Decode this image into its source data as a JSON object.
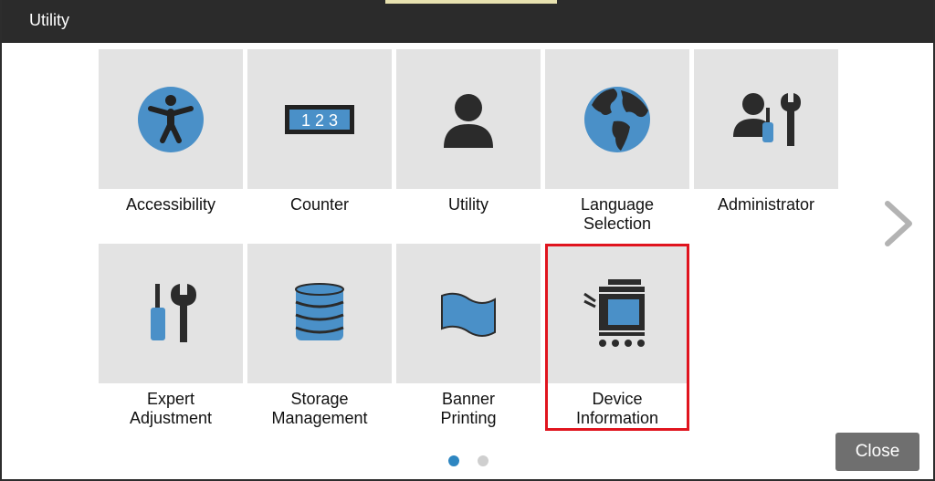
{
  "window": {
    "title": "Utility"
  },
  "colors": {
    "accent_blue": "#4a90c8",
    "icon_dark": "#2b2b2b",
    "tile_bg": "#e3e3e3",
    "selection_red": "#e0141e"
  },
  "tiles": [
    {
      "label": "Accessibility",
      "icon": "accessibility-icon"
    },
    {
      "label": "Counter",
      "icon": "counter-icon",
      "counter_text": "1 2 3"
    },
    {
      "label": "Utility",
      "icon": "person-icon"
    },
    {
      "label": "Language\nSelection",
      "icon": "globe-icon"
    },
    {
      "label": "Administrator",
      "icon": "administrator-icon"
    },
    {
      "label": "Expert\nAdjustment",
      "icon": "tools-icon"
    },
    {
      "label": "Storage\nManagement",
      "icon": "database-icon"
    },
    {
      "label": "Banner\nPrinting",
      "icon": "banner-icon"
    },
    {
      "label": "Device\nInformation",
      "icon": "printer-icon",
      "selected": true
    }
  ],
  "pager": {
    "current_page": 1,
    "total_pages": 2
  },
  "close_button": {
    "label": "Close"
  }
}
